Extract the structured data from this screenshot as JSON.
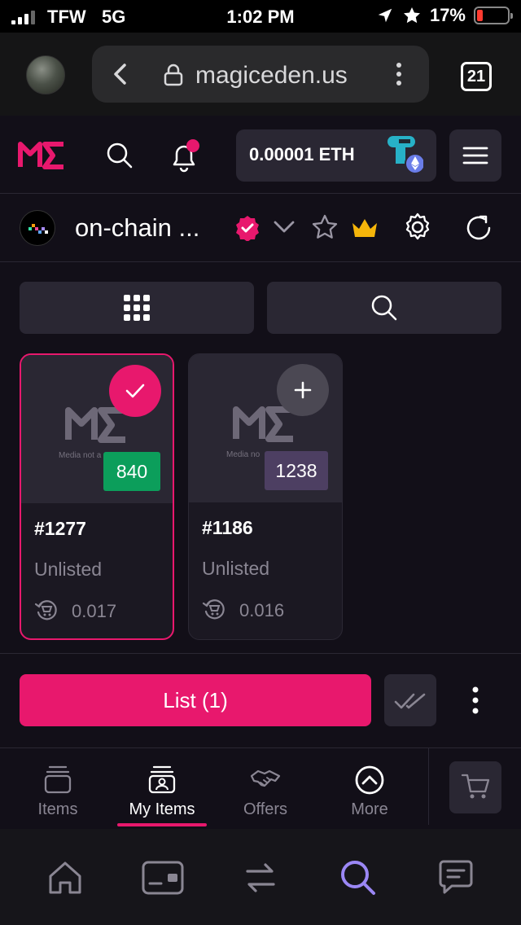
{
  "status_bar": {
    "carrier": "TFW",
    "network": "5G",
    "time": "1:02 PM",
    "battery": "17%",
    "battery_level": 0.17
  },
  "browser": {
    "url": "magiceden.us",
    "tab_count": "21"
  },
  "header": {
    "wallet_balance": "0.00001 ETH",
    "notification_dot_color": "#e8186d"
  },
  "collection": {
    "name": "on-chain ..."
  },
  "items": [
    {
      "id": "#1277",
      "rank": "840",
      "status": "Unlisted",
      "price": "0.017",
      "media_note": "Media not a",
      "selected": true,
      "rank_color": "#0c9e5b"
    },
    {
      "id": "#1186",
      "rank": "1238",
      "status": "Unlisted",
      "price": "0.016",
      "media_note": "Media no",
      "selected": false,
      "rank_color": "#4d3f62"
    }
  ],
  "actions": {
    "list_label": "List (1)"
  },
  "tabs": [
    {
      "label": "Items",
      "icon": "stack-icon"
    },
    {
      "label": "My Items",
      "icon": "user-stack-icon",
      "active": true
    },
    {
      "label": "Offers",
      "icon": "handshake-icon"
    },
    {
      "label": "More",
      "icon": "chevron-up-circle-icon"
    }
  ],
  "colors": {
    "accent": "#e8186d",
    "background": "#120f18",
    "surface": "#2a2733",
    "more_underline": "#9b87f5"
  }
}
